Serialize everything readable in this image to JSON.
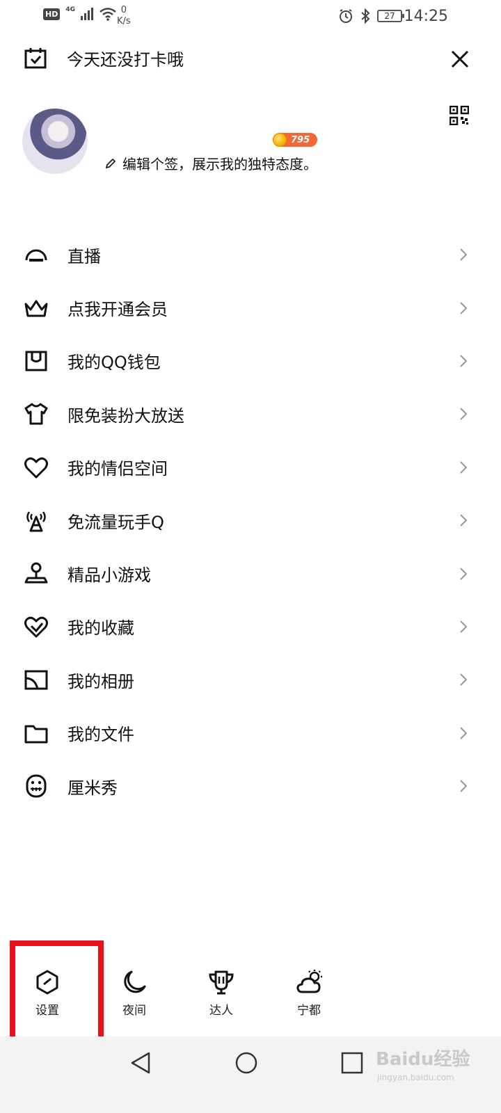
{
  "status_bar": {
    "network_badge": "HD",
    "network_type": "4G",
    "speed_value": "0",
    "speed_unit": "K/s",
    "battery": "27",
    "time": "14:25"
  },
  "header": {
    "checkin_text": "今天还没打卡哦"
  },
  "profile": {
    "coin_count": "795",
    "signature_placeholder": "编辑个签，展示我的独特态度。"
  },
  "menu": {
    "items": [
      {
        "label": "直播",
        "icon": "live-icon"
      },
      {
        "label": "点我开通会员",
        "icon": "crown-icon"
      },
      {
        "label": "我的QQ钱包",
        "icon": "wallet-icon"
      },
      {
        "label": "限免装扮大放送",
        "icon": "tshirt-icon"
      },
      {
        "label": "我的情侣空间",
        "icon": "heart-icon"
      },
      {
        "label": "免流量玩手Q",
        "icon": "signal-tower-icon"
      },
      {
        "label": "精品小游戏",
        "icon": "joystick-icon"
      },
      {
        "label": "我的收藏",
        "icon": "favorite-icon"
      },
      {
        "label": "我的相册",
        "icon": "album-icon"
      },
      {
        "label": "我的文件",
        "icon": "folder-icon"
      },
      {
        "label": "厘米秀",
        "icon": "cmshow-icon"
      }
    ]
  },
  "tools": {
    "settings": "设置",
    "night": "夜间",
    "expert": "达人",
    "weather": "宁都"
  },
  "colors": {
    "highlight": "#e8121e",
    "coin_badge": "#f0683a"
  },
  "watermark": {
    "brand": "Baidu经验",
    "url": "jingyan.baidu.com"
  }
}
